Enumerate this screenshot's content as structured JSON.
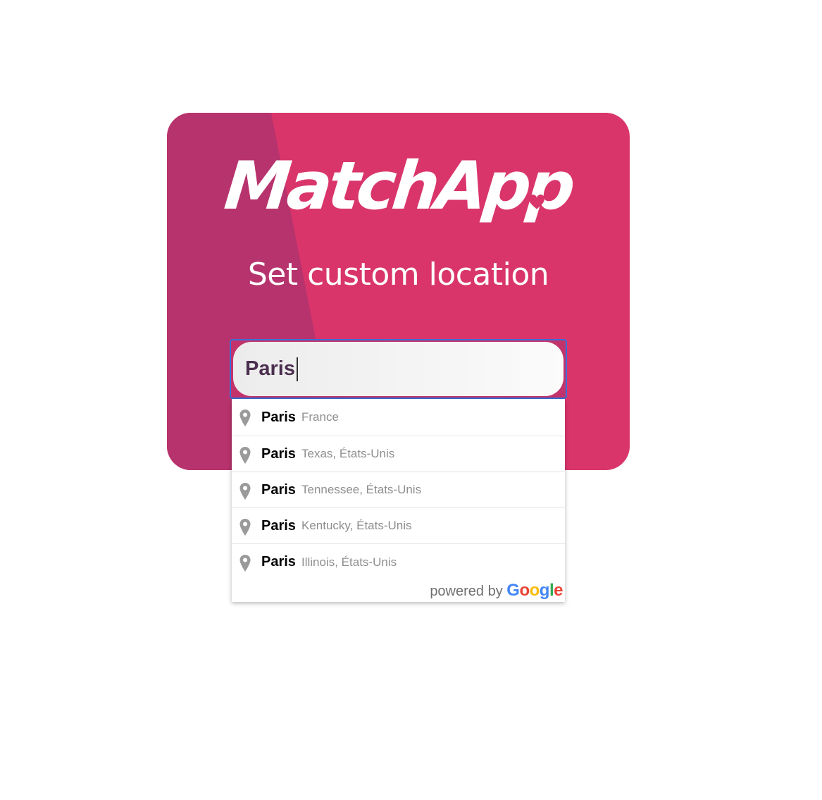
{
  "app": {
    "logo_text": "MatchApp",
    "subtitle": "Set custom location"
  },
  "search": {
    "value": "Paris"
  },
  "suggestions": [
    {
      "main": "Paris",
      "secondary": "France"
    },
    {
      "main": "Paris",
      "secondary": "Texas, États-Unis"
    },
    {
      "main": "Paris",
      "secondary": "Tennessee, États-Unis"
    },
    {
      "main": "Paris",
      "secondary": "Kentucky, États-Unis"
    },
    {
      "main": "Paris",
      "secondary": "Illinois, États-Unis"
    }
  ],
  "attribution": {
    "prefix": "powered by",
    "brand_letters": [
      "G",
      "o",
      "o",
      "g",
      "l",
      "e"
    ]
  },
  "colors": {
    "card_background": "#d9356b",
    "card_shade": "#b7336d",
    "input_focus_border": "#3b6fd8",
    "pin_icon": "#9a9a9a"
  },
  "icons": {
    "suggestion_icon": "map-pin-icon",
    "logo_decoration": "heart-icon"
  }
}
